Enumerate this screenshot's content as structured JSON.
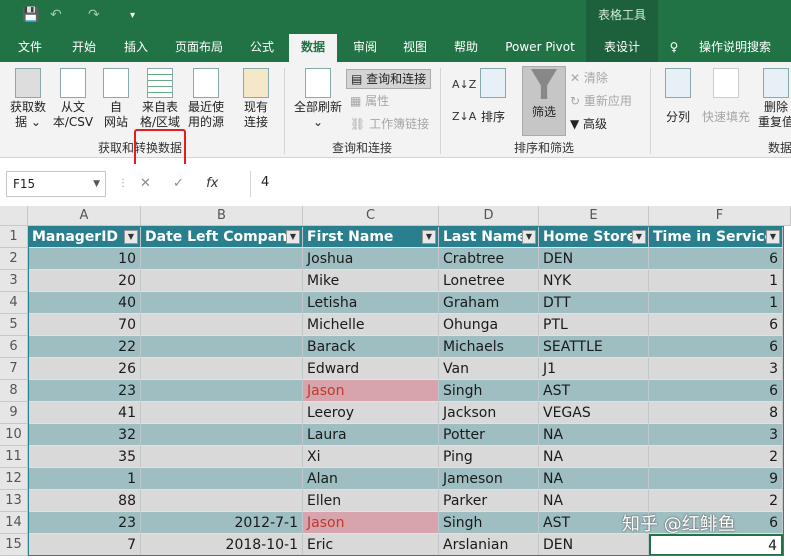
{
  "quick_access": {
    "save": "💾",
    "undo": "↶",
    "redo": "↷",
    "more": "▾"
  },
  "context_title": "表格工具",
  "tabs": [
    "文件",
    "开始",
    "插入",
    "页面布局",
    "公式",
    "数据",
    "审阅",
    "视图",
    "帮助",
    "Power Pivot",
    "表设计",
    "操作说明搜索"
  ],
  "ribbon": {
    "get_data": "获取数\n据 ⌄",
    "from_csv": "从文\n本/CSV",
    "from_web": "自\n网站",
    "from_table": "来自表\n格/区域",
    "recent": "最近使\n用的源",
    "existing": "现有\n连接",
    "refresh_all": "全部刷新\n⌄",
    "queries": "查询和连接",
    "properties": "属性",
    "edit_links": "工作簿链接",
    "sort_asc": "A↓Z",
    "sort_desc": "Z↓A",
    "sort": "排序",
    "filter": "筛选",
    "clear": "清除",
    "reapply": "重新应用",
    "advanced": "高级",
    "split": "分列",
    "flash_fill": "快速填充",
    "remove_dup": "删除\n重复值",
    "group_get": "获取和转换数据",
    "group_query": "查询和连接",
    "group_sort": "排序和筛选",
    "group_tools": "数据"
  },
  "formula_bar": {
    "name_box": "F15",
    "cancel": "✕",
    "enter": "✓",
    "fx": "fx",
    "value": "4"
  },
  "columns": [
    "A",
    "B",
    "C",
    "D",
    "E",
    "F"
  ],
  "rows": [
    "1",
    "2",
    "3",
    "4",
    "5",
    "6",
    "7",
    "8",
    "9",
    "10",
    "11",
    "12",
    "13",
    "14",
    "15"
  ],
  "table": {
    "headers": [
      "ManagerID",
      "Date Left Company",
      "First Name",
      "Last Name",
      "Home Store",
      "Time in Service"
    ],
    "data": [
      [
        "10",
        "",
        "Joshua",
        "Crabtree",
        "DEN",
        "6"
      ],
      [
        "20",
        "",
        "Mike",
        "Lonetree",
        "NYK",
        "1"
      ],
      [
        "40",
        "",
        "Letisha",
        "Graham",
        "DTT",
        "1"
      ],
      [
        "70",
        "",
        "Michelle",
        "Ohunga",
        "PTL",
        "6"
      ],
      [
        "22",
        "",
        "Barack",
        "Michaels",
        "SEATTLE",
        "6"
      ],
      [
        "26",
        "",
        "Edward",
        "Van",
        "J1",
        "3"
      ],
      [
        "23",
        "",
        "Jason",
        "Singh",
        "AST",
        "6"
      ],
      [
        "41",
        "",
        "Leeroy",
        "Jackson",
        "VEGAS",
        "8"
      ],
      [
        "32",
        "",
        "Laura",
        "Potter",
        "NA",
        "3"
      ],
      [
        "35",
        "",
        "Xi",
        "Ping",
        "NA",
        "2"
      ],
      [
        "1",
        "",
        "Alan",
        "Jameson",
        "NA",
        "9"
      ],
      [
        "88",
        "",
        "Ellen",
        "Parker",
        "NA",
        "2"
      ],
      [
        "23",
        "2012-7-1",
        "Jason",
        "Singh",
        "AST",
        "6"
      ],
      [
        "7",
        "2018-10-1",
        "Eric",
        "Arslanian",
        "DEN",
        "4"
      ]
    ],
    "highlight_rows": [
      6,
      12
    ]
  },
  "watermark": "知乎 @红鲱鱼",
  "colors": {
    "excel_green": "#217346",
    "table_header": "#2a7f8f",
    "band_dark": "#9ebec2",
    "band_light": "#d9d9d9",
    "highlight": "#d7a4ad",
    "annotation": "#e02020"
  }
}
